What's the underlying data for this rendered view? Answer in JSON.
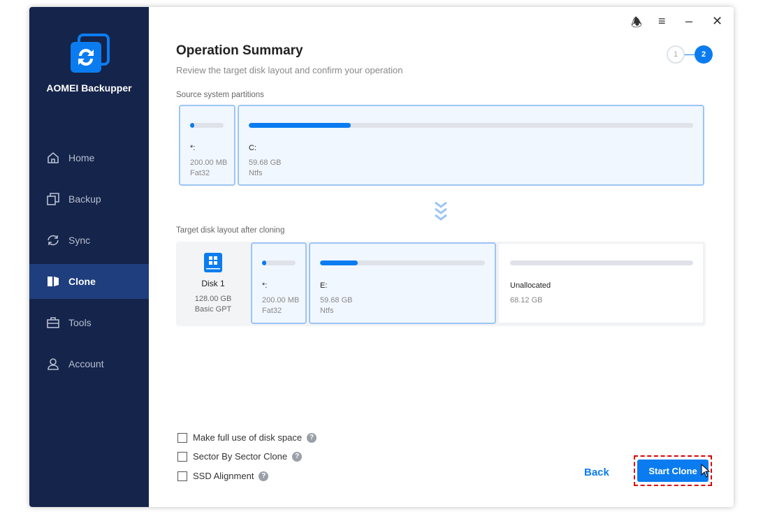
{
  "app": {
    "name": "AOMEI Backupper"
  },
  "sidebar": {
    "items": [
      {
        "label": "Home",
        "icon": "home-icon"
      },
      {
        "label": "Backup",
        "icon": "backup-icon"
      },
      {
        "label": "Sync",
        "icon": "sync-icon"
      },
      {
        "label": "Clone",
        "icon": "clone-icon",
        "active": true
      },
      {
        "label": "Tools",
        "icon": "tools-icon"
      },
      {
        "label": "Account",
        "icon": "account-icon"
      }
    ]
  },
  "header": {
    "title": "Operation Summary",
    "subtitle": "Review the target disk layout and confirm your operation",
    "steps": [
      "1",
      "2"
    ],
    "current_step": 2
  },
  "source": {
    "label": "Source system partitions",
    "partitions": [
      {
        "name": "*:",
        "size": "200.00 MB",
        "fs": "Fat32",
        "used_pct": 10
      },
      {
        "name": "C:",
        "size": "59.68 GB",
        "fs": "Ntfs",
        "used_pct": 23
      }
    ]
  },
  "target": {
    "label": "Target disk layout after cloning",
    "disk": {
      "name": "Disk 1",
      "size": "128.00 GB",
      "type": "Basic GPT"
    },
    "partitions": [
      {
        "name": "*:",
        "size": "200.00 MB",
        "fs": "Fat32",
        "used_pct": 10
      },
      {
        "name": "E:",
        "size": "59.68 GB",
        "fs": "Ntfs",
        "used_pct": 23
      },
      {
        "name": "Unallocated",
        "size": "68.12 GB",
        "used_pct": 0
      }
    ]
  },
  "options": [
    {
      "label": "Make full use of disk space",
      "checked": false
    },
    {
      "label": "Sector By Sector Clone",
      "checked": false
    },
    {
      "label": "SSD Alignment",
      "checked": false
    }
  ],
  "help": "?",
  "buttons": {
    "back": "Back",
    "start": "Start Clone"
  },
  "colors": {
    "sidebar": "#15244a",
    "accent": "#0b7cf0",
    "highlight": "#e00000"
  }
}
